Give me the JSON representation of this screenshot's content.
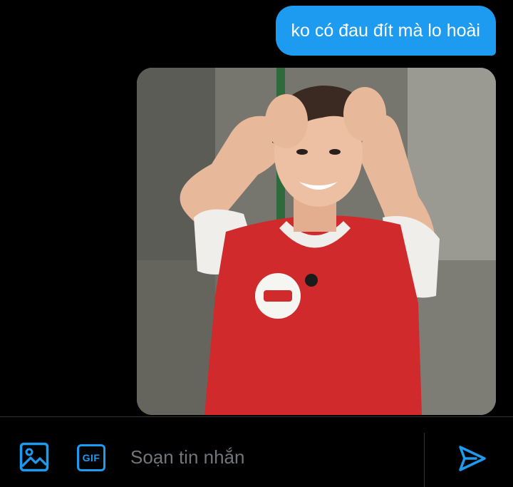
{
  "conversation": {
    "messages": [
      {
        "type": "text",
        "sender": "self",
        "text": "ko có đau đít mà lo hoài"
      },
      {
        "type": "image",
        "sender": "self",
        "description": "Photo of a young man in a red mesh bib over a white T-shirt, smiling with both hands on his head; name tag with Korean text"
      }
    ]
  },
  "composer": {
    "placeholder": "Soạn tin nhắn",
    "media_icon": "image-icon",
    "gif_label": "GIF",
    "send_icon": "send-icon"
  },
  "colors": {
    "background": "#000000",
    "accent": "#1d9bf0",
    "placeholder": "#71767b",
    "divider": "#2f3336"
  }
}
